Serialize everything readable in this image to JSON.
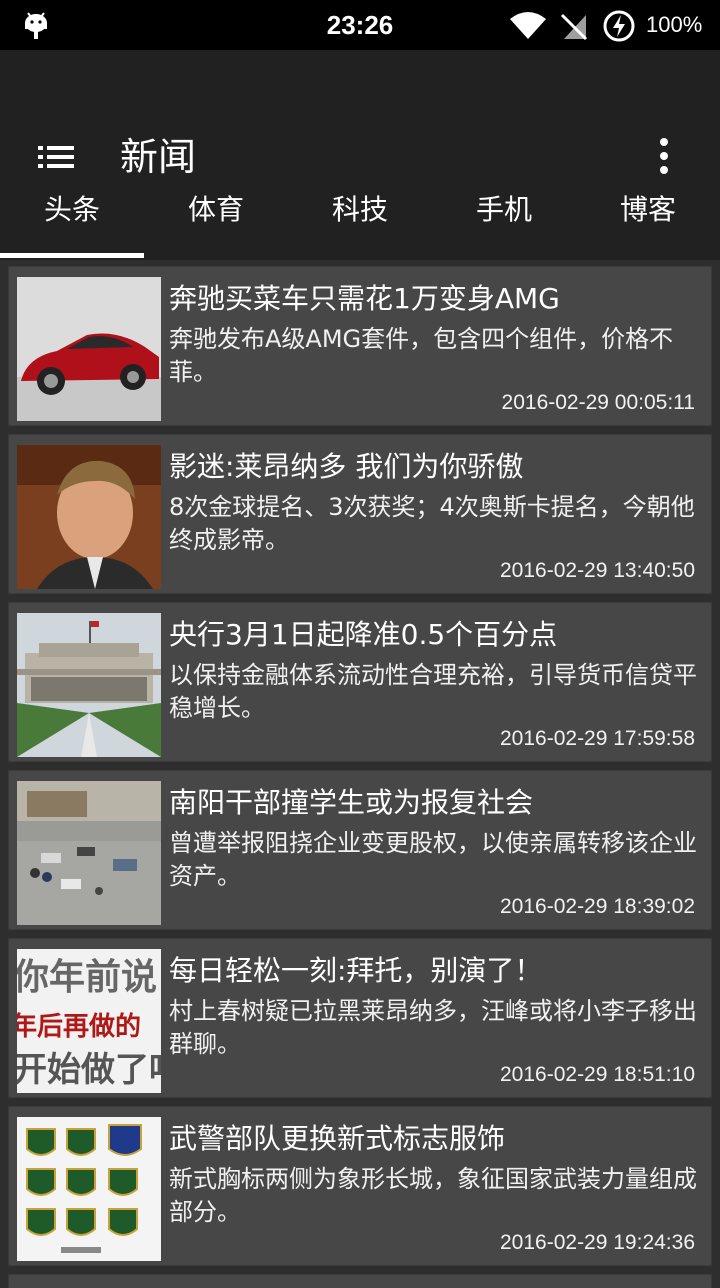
{
  "status_bar": {
    "time": "23:26",
    "battery": "100%"
  },
  "app_bar": {
    "title": "新闻",
    "menu_icon": "list-menu-icon",
    "more_icon": "more-vert-icon"
  },
  "tabs": [
    {
      "label": "头条",
      "active": true
    },
    {
      "label": "体育",
      "active": false
    },
    {
      "label": "科技",
      "active": false
    },
    {
      "label": "手机",
      "active": false
    },
    {
      "label": "博客",
      "active": false
    }
  ],
  "news": [
    {
      "title": "奔驰买菜车只需花1万变身AMG",
      "summary": "奔驰发布A级AMG套件，包含四个组件，价格不菲。",
      "time": "2016-02-29 00:05:11",
      "thumb": "red-car-photo"
    },
    {
      "title": "影迷:莱昂纳多 我们为你骄傲",
      "summary": "8次金球提名、3次获奖；4次奥斯卡提名，今朝他终成影帝。",
      "time": "2016-02-29 13:40:50",
      "thumb": "portrait-photo"
    },
    {
      "title": "央行3月1日起降准0.5个百分点",
      "summary": "以保持金融体系流动性合理充裕，引导货币信贷平稳增长。",
      "time": "2016-02-29 17:59:58",
      "thumb": "bank-building-photo"
    },
    {
      "title": "南阳干部撞学生或为报复社会",
      "summary": "曾遭举报阻挠企业变更股权，以使亲属转移该企业资产。",
      "time": "2016-02-29 18:39:02",
      "thumb": "street-scene-photo"
    },
    {
      "title": "每日轻松一刻:拜托，别演了！",
      "summary": "村上春树疑已拉黑莱昂纳多，汪峰或将小李子移出群聊。",
      "time": "2016-02-29 18:51:10",
      "thumb": "text-poster-image",
      "thumb_text": [
        "你年前说",
        "年后再做的",
        "开始做了吗"
      ]
    },
    {
      "title": "武警部队更换新式标志服饰",
      "summary": "新式胸标两侧为象形长城，象征国家武装力量组成部分。",
      "time": "2016-02-29 19:24:36",
      "thumb": "badges-photo"
    }
  ]
}
